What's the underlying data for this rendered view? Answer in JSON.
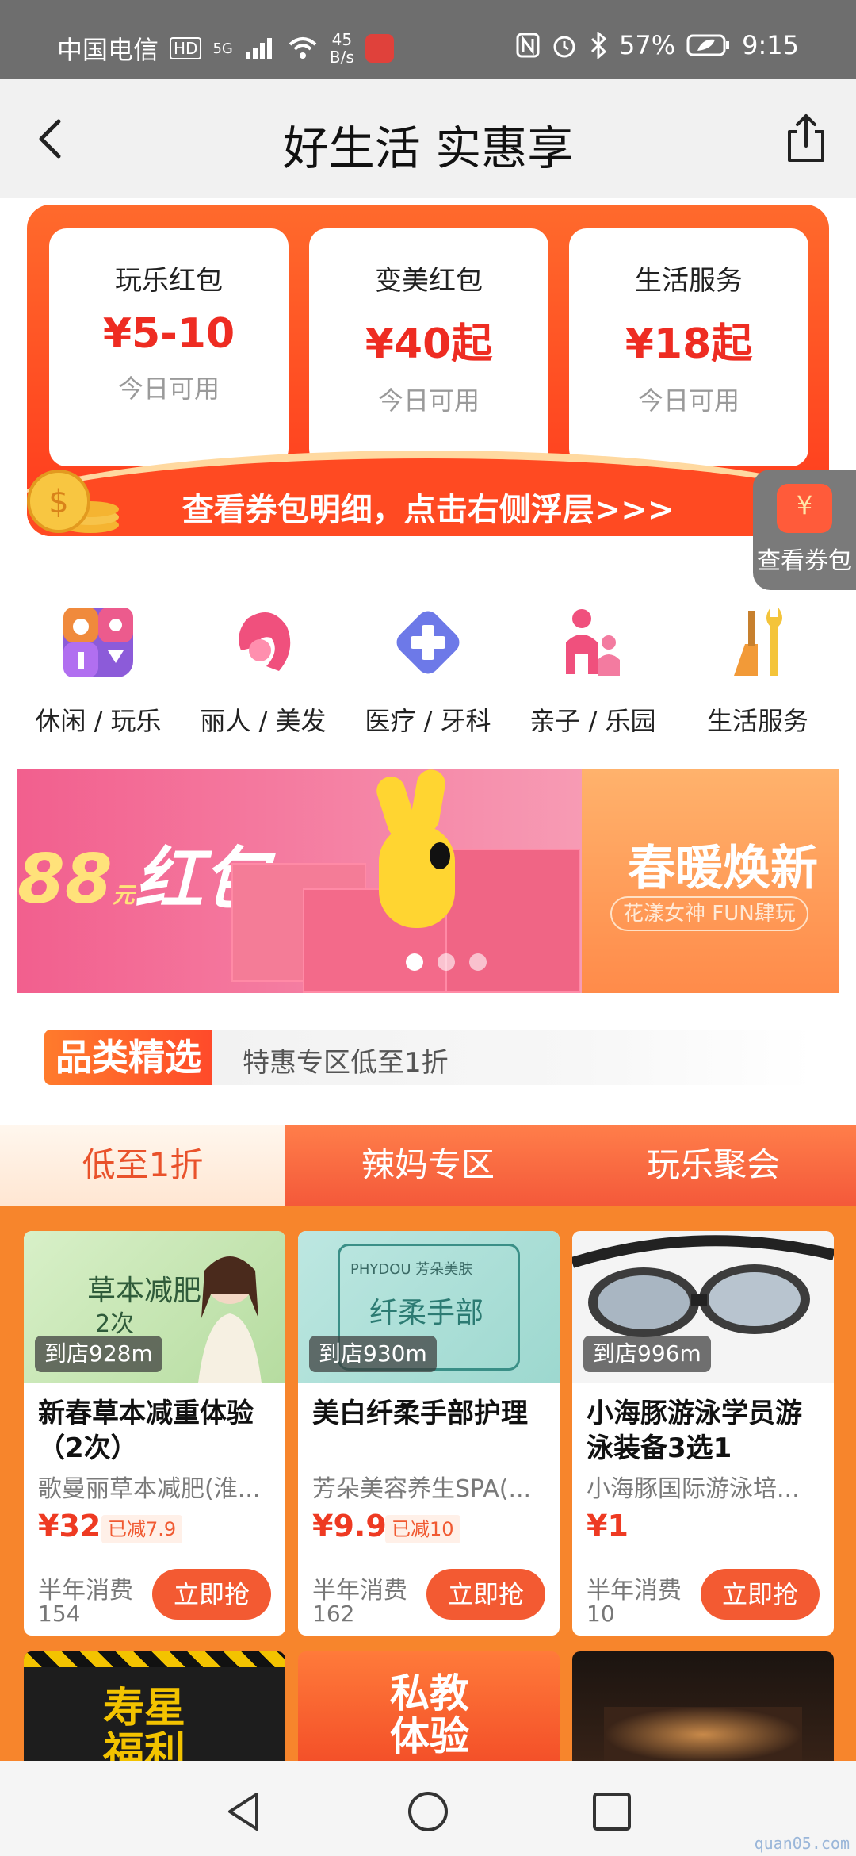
{
  "status_bar": {
    "carrier": "中国电信",
    "hd": "HD",
    "network": "5G",
    "speed_value": "45",
    "speed_unit": "B/s",
    "battery": "57%",
    "time": "9:15"
  },
  "nav": {
    "title": "好生活 实惠享"
  },
  "coupons": [
    {
      "name": "玩乐红包",
      "amount": "¥5-10",
      "sub": "今日可用"
    },
    {
      "name": "变美红包",
      "amount": "¥40起",
      "sub": "今日可用"
    },
    {
      "name": "生活服务",
      "amount": "¥18起",
      "sub": "今日可用"
    }
  ],
  "coupon_cta": "查看券包明细，点击右侧浮层>>>",
  "float_button": {
    "icon_text": "¥",
    "label": "查看券包"
  },
  "categories": [
    {
      "label": "休闲 / 玩乐",
      "icon": "leisure-icon"
    },
    {
      "label": "丽人 / 美发",
      "icon": "beauty-icon"
    },
    {
      "label": "医疗 / 牙科",
      "icon": "medical-icon"
    },
    {
      "label": "亲子 / 乐园",
      "icon": "family-icon"
    },
    {
      "label": "生活服务",
      "icon": "life-service-icon"
    }
  ],
  "promo": {
    "left_big": "88",
    "left_unit": "元",
    "left_word": "红包",
    "right_title": "春暖焕新",
    "right_sub": "花漾女神 FUN肆玩"
  },
  "section": {
    "tag": "品类精选",
    "desc": "特惠专区低至1折"
  },
  "tabs": [
    {
      "label": "低至1折",
      "active": true
    },
    {
      "label": "辣妈专区",
      "active": false
    },
    {
      "label": "玩乐聚会",
      "active": false
    }
  ],
  "products": [
    {
      "distance": "到店928m",
      "img_text_1": "草本减肥",
      "img_text_2": "2次",
      "title": "新春草本减重体验（2次）",
      "shop": "歌曼丽草本减肥(淮...",
      "price": "¥32",
      "off": "已减7.9",
      "sales_label": "半年消费",
      "sales": "154",
      "button": "立即抢"
    },
    {
      "distance": "到店930m",
      "img_text_1": "PHYDOU 芳朵美肤",
      "img_text_2": "纤柔手部",
      "title": "美白纤柔手部护理",
      "shop": "芳朵美容养生SPA(...",
      "price": "¥9.9",
      "off": "已减10",
      "sales_label": "半年消费",
      "sales": "162",
      "button": "立即抢"
    },
    {
      "distance": "到店996m",
      "img_text_1": "",
      "img_text_2": "",
      "title": "小海豚游泳学员游泳装备3选1",
      "shop": "小海豚国际游泳培...",
      "price": "¥1",
      "off": "",
      "sales_label": "半年消费",
      "sales": "10",
      "button": "立即抢"
    }
  ],
  "next_cards": [
    {
      "text": "寿星福利"
    },
    {
      "text": "私教体验"
    },
    {
      "text": ""
    }
  ],
  "watermark": "quan05.com",
  "colors": {
    "accent": "#f35a32",
    "coupon_red": "#ee2c22",
    "status_bar": "#6e6e6e",
    "product_bg": "#f7852c"
  }
}
